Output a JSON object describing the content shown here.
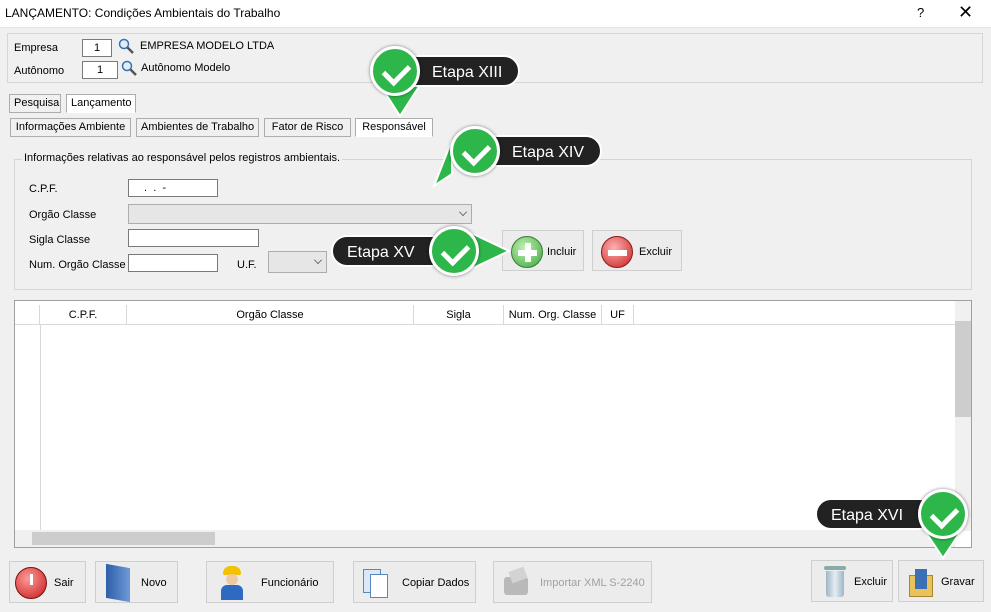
{
  "window": {
    "title": "LANÇAMENTO: Condições Ambientais do Trabalho",
    "help": "?",
    "close": "✕"
  },
  "header": {
    "empresa_label": "Empresa",
    "empresa_num": "1",
    "empresa_name": "EMPRESA MODELO LTDA",
    "autonomo_label": "Autônomo",
    "autonomo_num": "1",
    "autonomo_name": "Autônomo Modelo"
  },
  "tabs_main": [
    "Pesquisa",
    "Lançamento"
  ],
  "tabs_sub": [
    "Informações Ambiente",
    "Ambientes de Trabalho",
    "Fator de Risco",
    "Responsável"
  ],
  "form": {
    "group_title": "Informações relativas ao responsável pelos registros ambientais.",
    "cpf_label": "C.P.F.",
    "cpf_value": " .  .  -",
    "orgao_label": "Orgão Classe",
    "orgao_value": "",
    "sigla_label": "Sigla Classe",
    "sigla_value": "",
    "num_label": "Num. Orgão Classe",
    "num_value": "",
    "uf_label": "U.F.",
    "uf_value": "",
    "incluir": "Incluir",
    "excluir": "Excluir"
  },
  "grid": {
    "columns": [
      "C.P.F.",
      "Orgão Classe",
      "Sigla",
      "Num. Org. Classe",
      "UF"
    ],
    "rows": []
  },
  "footer": {
    "sair": "Sair",
    "novo": "Novo",
    "funcionario": "Funcionário",
    "copiar": "Copiar Dados",
    "importar": "Importar XML S-2240",
    "excluir": "Excluir",
    "gravar": "Gravar"
  },
  "callouts": [
    "Etapa XIII",
    "Etapa XIV",
    "Etapa XV",
    "Etapa XVI"
  ],
  "colors": {
    "accent_green": "#2db64a",
    "callout_bg": "#222222"
  }
}
